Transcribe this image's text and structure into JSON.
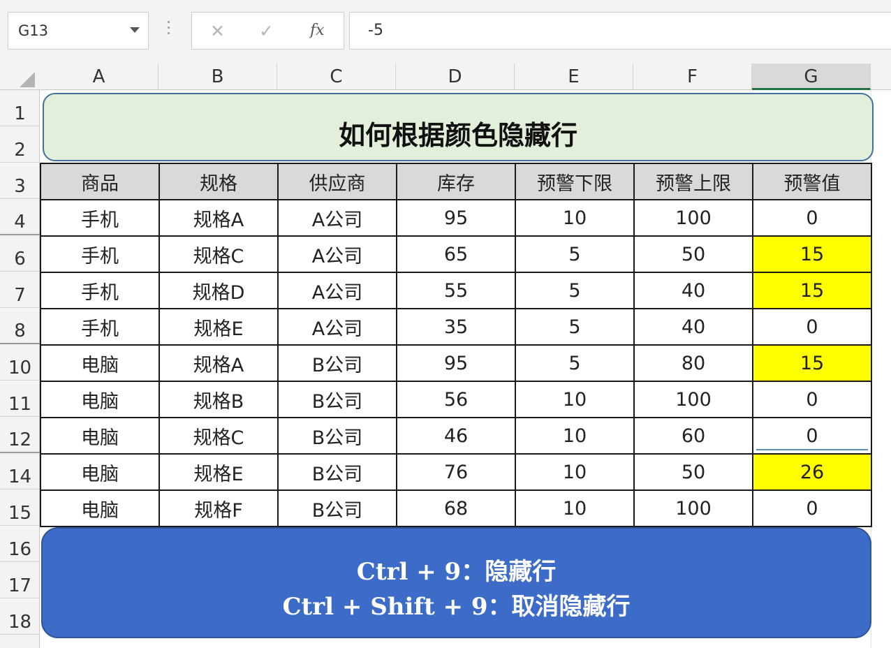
{
  "formula_bar": {
    "name_box": "G13",
    "cancel_icon": "close-icon",
    "confirm_icon": "check-icon",
    "fx_label": "fx",
    "formula_value": "-5"
  },
  "columns": [
    "A",
    "B",
    "C",
    "D",
    "E",
    "F",
    "G"
  ],
  "selected_column": "G",
  "row_numbers": [
    "1",
    "2",
    "3",
    "4",
    "6",
    "7",
    "8",
    "10",
    "11",
    "12",
    "14",
    "15",
    "16",
    "17",
    "18"
  ],
  "title": "如何根据颜色隐藏行",
  "table": {
    "headers": [
      "商品",
      "规格",
      "供应商",
      "库存",
      "预警下限",
      "预警上限",
      "预警值"
    ],
    "rows": [
      [
        "手机",
        "规格A",
        "A公司",
        "95",
        "10",
        "100",
        "0"
      ],
      [
        "手机",
        "规格C",
        "A公司",
        "65",
        "5",
        "50",
        "15"
      ],
      [
        "手机",
        "规格D",
        "A公司",
        "55",
        "5",
        "40",
        "15"
      ],
      [
        "手机",
        "规格E",
        "A公司",
        "35",
        "5",
        "40",
        "0"
      ],
      [
        "电脑",
        "规格A",
        "B公司",
        "95",
        "5",
        "80",
        "15"
      ],
      [
        "电脑",
        "规格B",
        "B公司",
        "56",
        "10",
        "100",
        "0"
      ],
      [
        "电脑",
        "规格C",
        "B公司",
        "46",
        "10",
        "60",
        "0"
      ],
      [
        "电脑",
        "规格E",
        "B公司",
        "76",
        "10",
        "50",
        "26"
      ],
      [
        "电脑",
        "规格F",
        "B公司",
        "68",
        "10",
        "100",
        "0"
      ]
    ],
    "highlighted_rows": [
      1,
      2,
      4,
      7
    ],
    "highlight_color": "#ffff00"
  },
  "shortcuts": {
    "line1": "Ctrl + 9：隐藏行",
    "line2": "Ctrl + Shift + 9：取消隐藏行"
  },
  "colors": {
    "title_fill": "#e2efda",
    "banner_fill": "#3c6cc8",
    "header_fill": "#d9d9d9",
    "accent": "#217346"
  }
}
